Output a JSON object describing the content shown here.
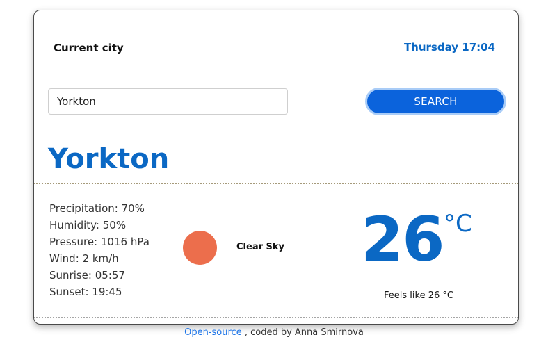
{
  "header": {
    "current_city_label": "Current city",
    "date_time": "Thursday 17:04"
  },
  "search": {
    "value": "Yorkton",
    "button_label": "SEARCH"
  },
  "weather": {
    "city": "Yorkton",
    "details": [
      "Precipitation: 70%",
      "Humidity: 50%",
      "Pressure: 1016 hPa",
      "Wind: 2 km/h",
      "Sunrise: 05:57",
      "Sunset: 19:45"
    ],
    "icon": "sun-icon",
    "icon_color": "#ec6e4c",
    "description": "Clear Sky",
    "temperature": "26",
    "unit": "°C",
    "feels_like": "Feels like 26 °C"
  },
  "footer": {
    "link_text": "Open-source",
    "credit_text": " , coded by Anna Smirnova"
  },
  "colors": {
    "accent": "#0b68c4",
    "button": "#0b63dc"
  }
}
